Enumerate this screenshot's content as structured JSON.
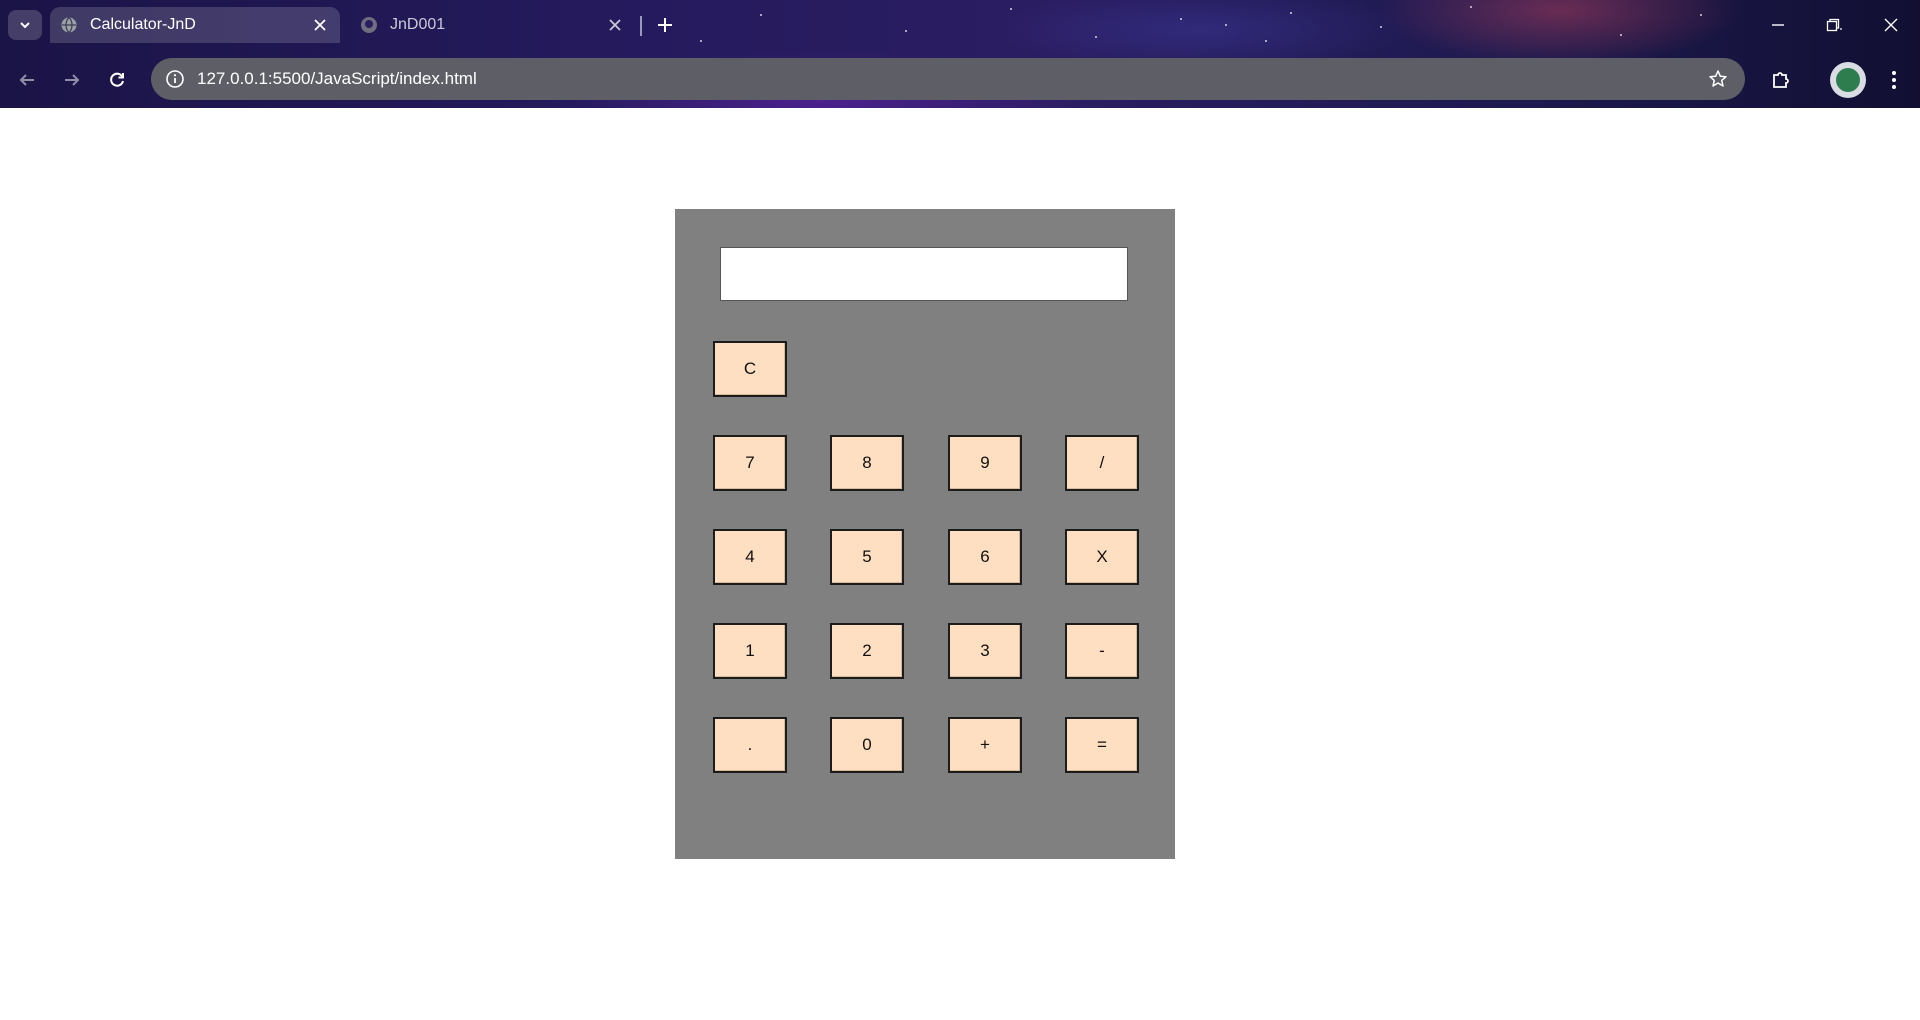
{
  "browser": {
    "tabs": [
      {
        "title": "Calculator-JnD",
        "active": true,
        "favicon": "globe-icon"
      },
      {
        "title": "JnD001",
        "active": false,
        "favicon": "github-icon"
      }
    ],
    "address_bar": {
      "url": "127.0.0.1:5500/JavaScript/index.html"
    }
  },
  "calculator": {
    "display_value": "",
    "keys": {
      "clear": "C",
      "seven": "7",
      "eight": "8",
      "nine": "9",
      "divide": "/",
      "four": "4",
      "five": "5",
      "six": "6",
      "multiply": "X",
      "one": "1",
      "two": "2",
      "three": "3",
      "subtract": "-",
      "decimal": ".",
      "zero": "0",
      "add": "+",
      "equals": "="
    },
    "colors": {
      "body": "#808080",
      "key": "#ffdfc1",
      "display": "#ffffff"
    }
  }
}
